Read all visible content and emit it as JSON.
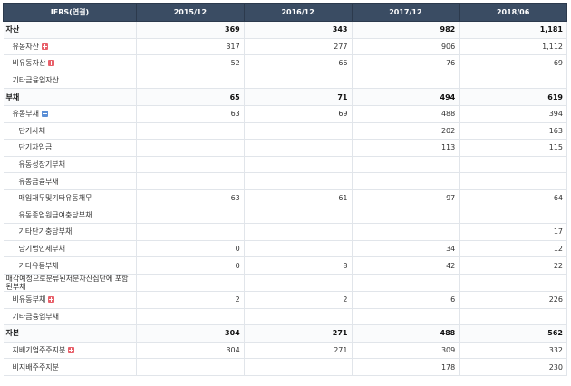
{
  "table": {
    "header": [
      "IFRS(연결)",
      "2015/12",
      "2016/12",
      "2017/12",
      "2018/06"
    ],
    "rows": [
      {
        "label": "자산",
        "kind": "sec",
        "values": [
          "369",
          "343",
          "982",
          "1,181"
        ]
      },
      {
        "label": "유동자산",
        "kind": "item",
        "toggle": "expand",
        "values": [
          "317",
          "277",
          "906",
          "1,112"
        ]
      },
      {
        "label": "비유동자산",
        "kind": "item",
        "toggle": "expand",
        "values": [
          "52",
          "66",
          "76",
          "69"
        ]
      },
      {
        "label": "기타금융업자산",
        "kind": "item",
        "values": [
          "",
          "",
          "",
          ""
        ]
      },
      {
        "label": "부채",
        "kind": "sec",
        "values": [
          "65",
          "71",
          "494",
          "619"
        ]
      },
      {
        "label": "유동부채",
        "kind": "item",
        "toggle": "collapse",
        "values": [
          "63",
          "69",
          "488",
          "394"
        ]
      },
      {
        "label": "단기사채",
        "kind": "sub",
        "values": [
          "",
          "",
          "202",
          "163"
        ]
      },
      {
        "label": "단기차입금",
        "kind": "sub",
        "values": [
          "",
          "",
          "113",
          "115"
        ]
      },
      {
        "label": "유동성장기부채",
        "kind": "sub",
        "values": [
          "",
          "",
          "",
          ""
        ]
      },
      {
        "label": "유동금융부채",
        "kind": "sub",
        "values": [
          "",
          "",
          "",
          ""
        ]
      },
      {
        "label": "매입채무및기타유동채무",
        "kind": "sub",
        "values": [
          "63",
          "61",
          "97",
          "64"
        ]
      },
      {
        "label": "유동종업원급여충당부채",
        "kind": "sub",
        "values": [
          "",
          "",
          "",
          ""
        ]
      },
      {
        "label": "기타단기충당부채",
        "kind": "sub",
        "values": [
          "",
          "",
          "",
          "17"
        ]
      },
      {
        "label": "당기법인세부채",
        "kind": "sub",
        "values": [
          "0",
          "",
          "34",
          "12"
        ]
      },
      {
        "label": "기타유동부채",
        "kind": "sub",
        "values": [
          "0",
          "8",
          "42",
          "22"
        ]
      },
      {
        "label": "매각예정으로분류된처분자산집단에 포함된부채",
        "kind": "multi",
        "values": [
          "",
          "",
          "",
          ""
        ]
      },
      {
        "label": "비유동부채",
        "kind": "item",
        "toggle": "expand",
        "values": [
          "2",
          "2",
          "6",
          "226"
        ]
      },
      {
        "label": "기타금융업부채",
        "kind": "item",
        "values": [
          "",
          "",
          "",
          ""
        ]
      },
      {
        "label": "자본",
        "kind": "sec",
        "values": [
          "304",
          "271",
          "488",
          "562"
        ]
      },
      {
        "label": "지배기업주주지분",
        "kind": "item",
        "toggle": "expand",
        "values": [
          "304",
          "271",
          "309",
          "332"
        ]
      },
      {
        "label": "비지배주주지분",
        "kind": "item",
        "values": [
          "",
          "",
          "178",
          "230"
        ]
      }
    ]
  }
}
